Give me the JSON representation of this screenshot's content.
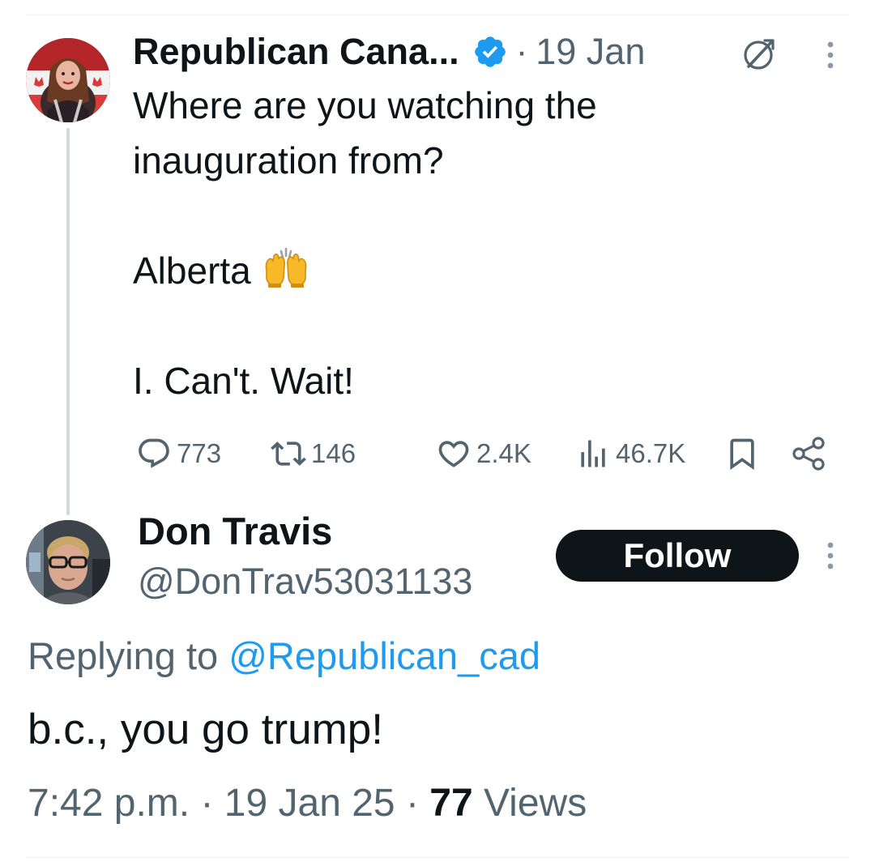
{
  "tweet": {
    "author": {
      "display_name": "Republican Cana...",
      "verified": true,
      "avatar": "profile-photo-red-maple-leaf"
    },
    "separator": "·",
    "date": "19 Jan",
    "text_lines": [
      "Where are you watching the",
      "inauguration from?",
      "",
      "Alberta",
      "",
      "I. Can't. Wait!"
    ],
    "emoji": "raising-hands",
    "stats": {
      "replies": "773",
      "reposts": "146",
      "likes": "2.4K",
      "views": "46.7K"
    }
  },
  "reply": {
    "author": {
      "display_name": "Don Travis",
      "handle": "@DonTrav53031133",
      "avatar": "profile-photo-man-glasses"
    },
    "follow_label": "Follow",
    "replying_prefix": "Replying to ",
    "replying_mention": "@Republican_cad",
    "text": "b.c., you go trump!",
    "time": "7:42 p.m.",
    "date": "19 Jan 25",
    "views_count": "77",
    "views_label": "Views",
    "separator": "·"
  },
  "colors": {
    "text": "#0f1419",
    "secondary": "#536471",
    "accent": "#1d9bf0",
    "thread_line": "#cfd9de",
    "button_bg": "#0f1419"
  }
}
